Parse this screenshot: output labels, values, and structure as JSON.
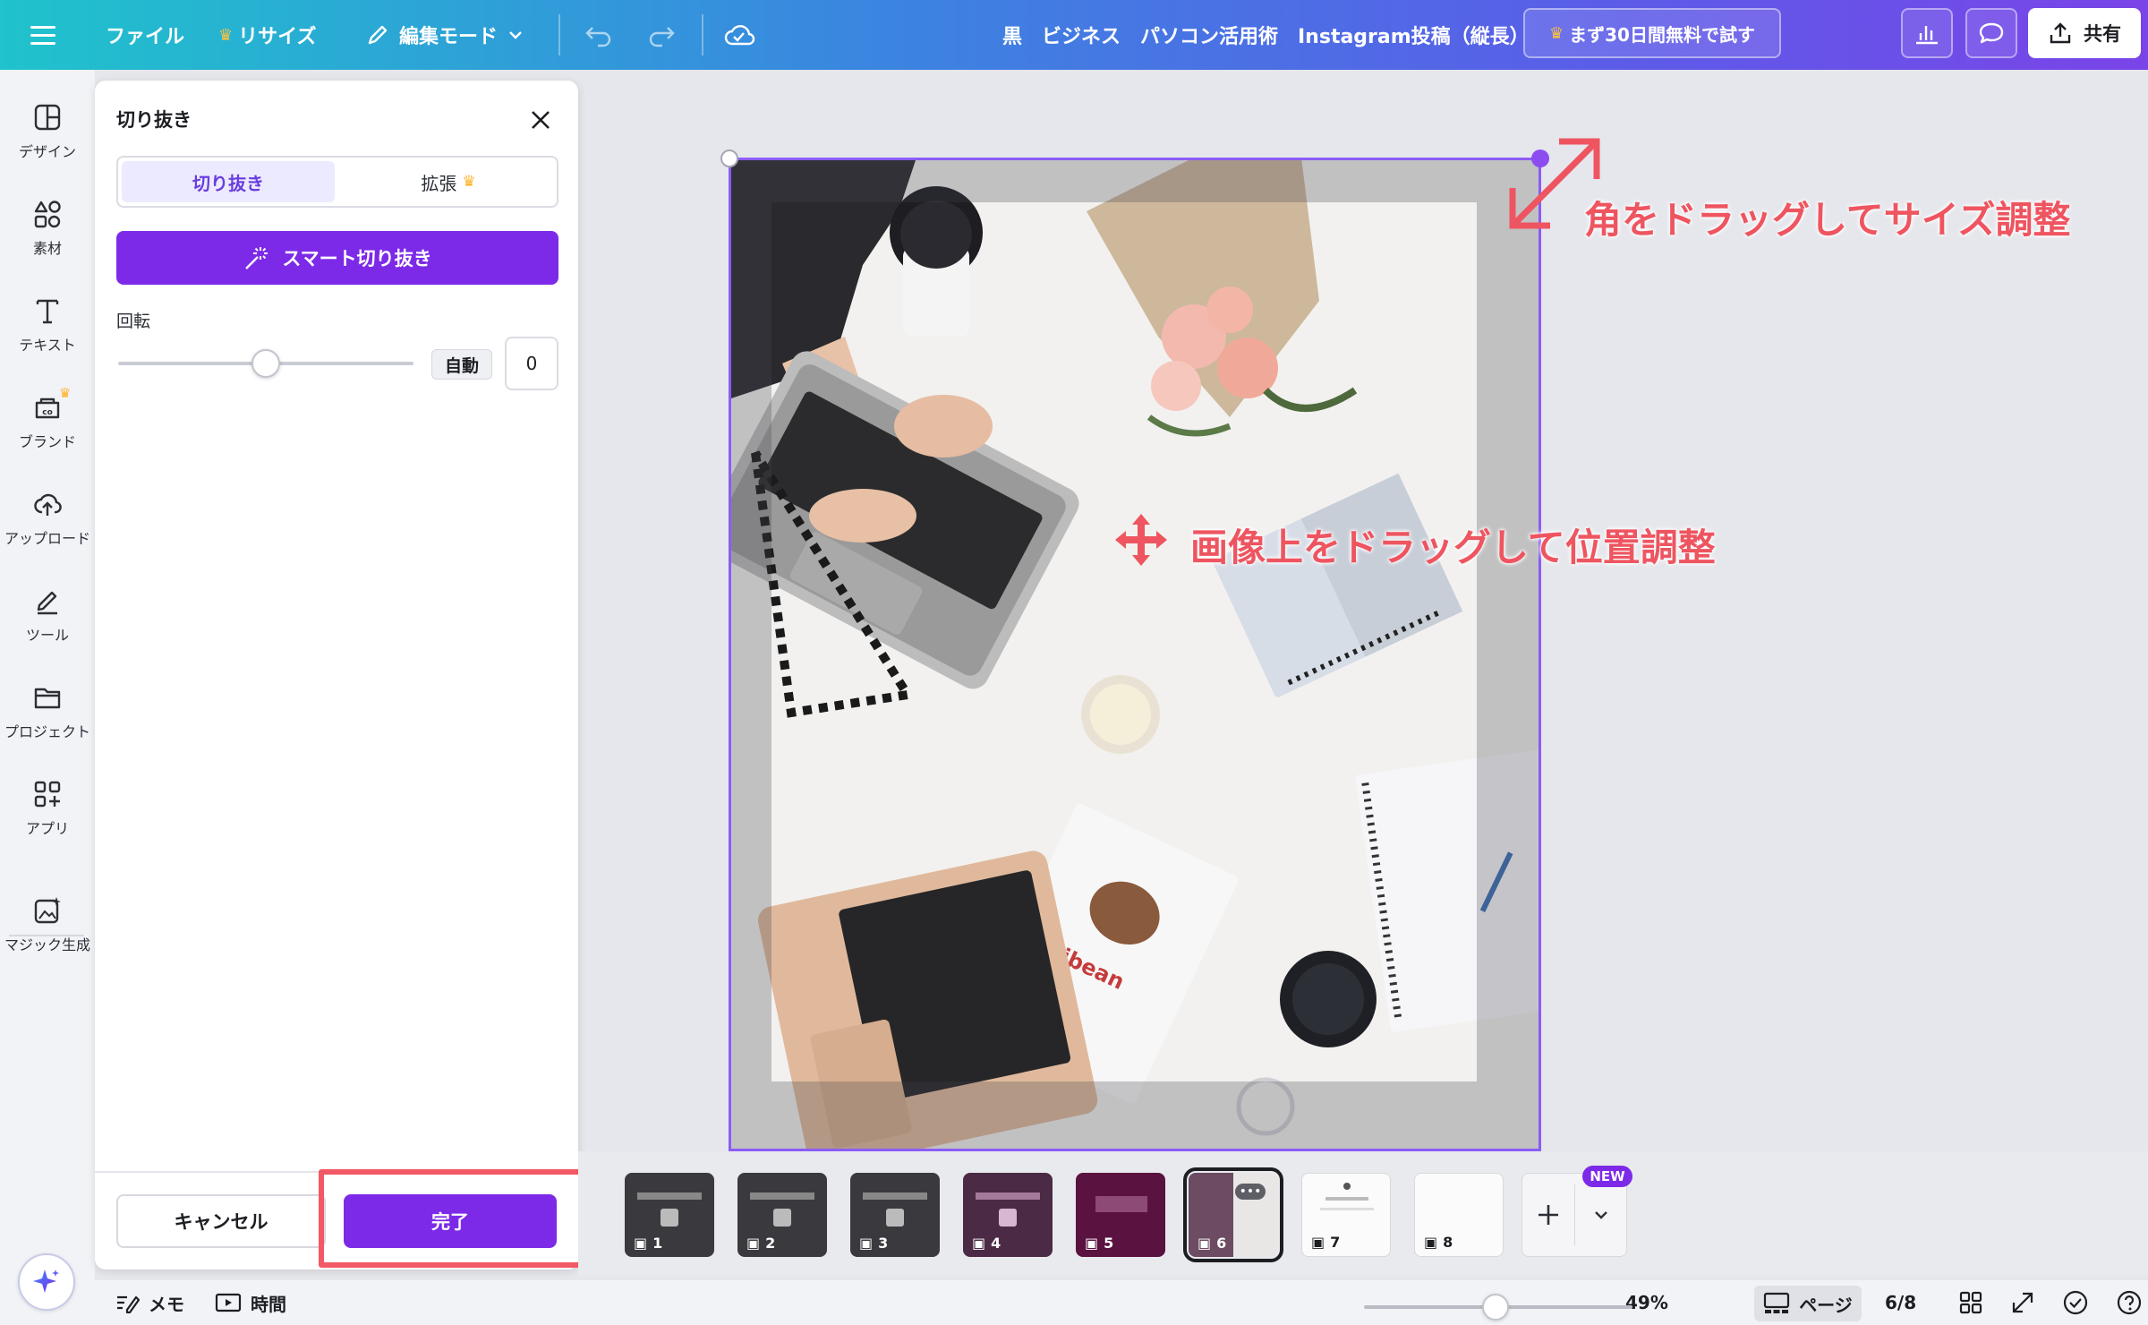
{
  "topbar": {
    "file": "ファイル",
    "resize": "リサイズ",
    "edit_mode": "編集モード",
    "doc_title": "黒　ビジネス　パソコン活用術　Instagram投稿（縦長）",
    "trial": "まず30日間無料で試す",
    "share": "共有"
  },
  "sidebar": {
    "items": [
      {
        "label": "デザイン",
        "icon": "design-icon"
      },
      {
        "label": "素材",
        "icon": "elements-icon"
      },
      {
        "label": "テキスト",
        "icon": "text-icon"
      },
      {
        "label": "ブランド",
        "icon": "brand-icon"
      },
      {
        "label": "アップロード",
        "icon": "upload-icon"
      },
      {
        "label": "ツール",
        "icon": "tools-icon"
      },
      {
        "label": "プロジェクト",
        "icon": "folder-icon"
      },
      {
        "label": "アプリ",
        "icon": "apps-icon"
      },
      {
        "label": "マジック生成",
        "icon": "magic-media-icon"
      }
    ]
  },
  "crop_panel": {
    "title": "切り抜き",
    "tab_crop": "切り抜き",
    "tab_expand": "拡張",
    "smart_crop": "スマート切り抜き",
    "rotation_label": "回転",
    "rotation_auto": "自動",
    "rotation_value": "0",
    "rotation_fraction": 0.5,
    "cancel": "キャンセル",
    "done": "完了"
  },
  "annotations": {
    "resize_hint": "角をドラッグしてサイズ調整",
    "move_hint": "画像上をドラッグして位置調整"
  },
  "pages": {
    "numbers": [
      "1",
      "2",
      "3",
      "4",
      "5",
      "6",
      "7",
      "8"
    ],
    "new_badge": "NEW",
    "current_index": 6
  },
  "bottombar": {
    "notes": "メモ",
    "timer": "時間",
    "zoom": "49%",
    "zoom_fraction": 0.49,
    "page_view": "ページ",
    "page_count": "6/8"
  },
  "colors": {
    "brand_purple": "#7d2ae8",
    "annotation_red": "#ee5560",
    "crop_frame": "#8b5cf6"
  }
}
